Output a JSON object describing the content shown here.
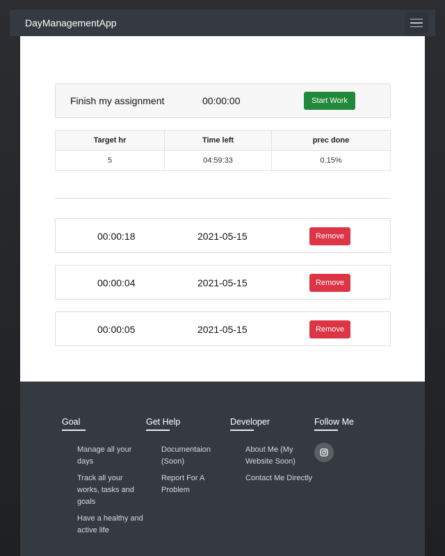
{
  "navbar": {
    "brand": "DayManagementApp"
  },
  "task": {
    "name": "Finish my assignment",
    "timer": "00:00:00",
    "start_label": "Start Work"
  },
  "stats": {
    "headers": [
      "Target hr",
      "Time left",
      "prec done"
    ],
    "values": [
      "5",
      "04:59:33",
      "0.15%"
    ]
  },
  "entries": [
    {
      "time": "00:00:18",
      "date": "2021-05-15",
      "remove_label": "Remove"
    },
    {
      "time": "00:00:04",
      "date": "2021-05-15",
      "remove_label": "Remove"
    },
    {
      "time": "00:00:05",
      "date": "2021-05-15",
      "remove_label": "Remove"
    }
  ],
  "footer": {
    "goal": {
      "title": "Goal",
      "items": [
        "Manage all your days",
        "Track all your works, tasks and goals",
        "Have a healthy and active life"
      ]
    },
    "help": {
      "title": "Get Help",
      "items": [
        "Documentaion (Soon)",
        "Report For A Problem"
      ]
    },
    "developer": {
      "title": "Developer",
      "items": [
        "About Me (My Website Soon)",
        "Contact Me Directly"
      ]
    },
    "follow": {
      "title": "Follow Me",
      "icon": "instagram-icon"
    }
  }
}
